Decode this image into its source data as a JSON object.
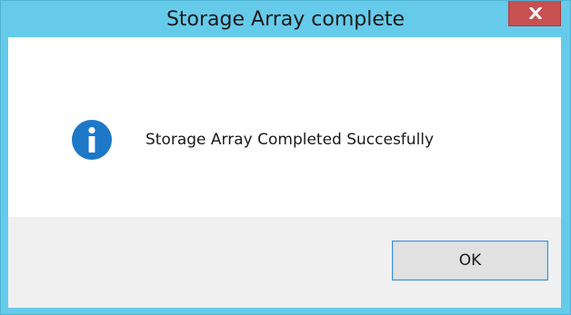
{
  "window": {
    "title": "Storage Array complete",
    "close_icon": "close-icon",
    "accent_color": "#66cbea",
    "close_color": "#c75050"
  },
  "dialog": {
    "icon": "info-icon",
    "icon_color": "#1e78c8",
    "message": "Storage Array Completed Succesfully"
  },
  "footer": {
    "ok_label": "OK"
  }
}
